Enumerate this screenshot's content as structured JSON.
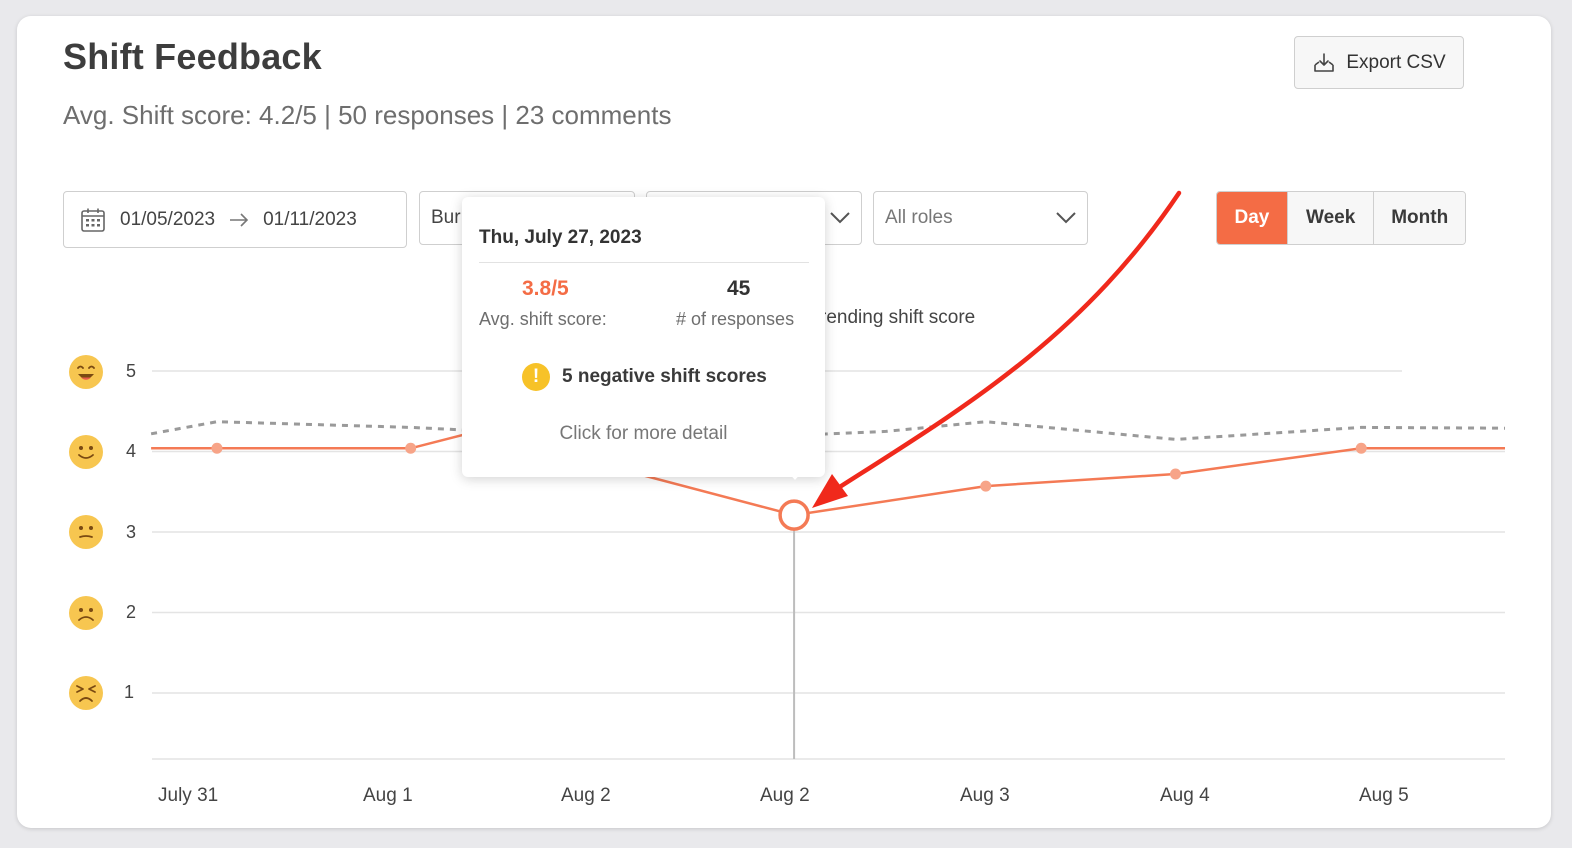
{
  "header": {
    "title": "Shift Feedback",
    "subtitle": "Avg. Shift score: 4.2/5 | 50 responses | 23 comments",
    "export_label": "Export CSV"
  },
  "filters": {
    "date_start": "01/05/2023",
    "date_end": "01/11/2023",
    "location_partial": "Bur",
    "roles": "All roles"
  },
  "period_toggle": [
    {
      "label": "Day",
      "active": true
    },
    {
      "label": "Week",
      "active": false
    },
    {
      "label": "Month",
      "active": false
    }
  ],
  "legend": {
    "trending_partial": "rending shift score"
  },
  "tooltip": {
    "date": "Thu, July 27, 2023",
    "avg_score": "3.8/5",
    "avg_score_label": "Avg. shift score:",
    "responses": "45",
    "responses_label": "# of responses",
    "warning": "5 negative shift scores",
    "warning_icon": "!",
    "link": "Click for more detail"
  },
  "colors": {
    "accent": "#f46c45",
    "score_line": "#f47a55",
    "trend_line": "#9a9a9a",
    "annotation_arrow": "#f0291c",
    "emoji": "#f7c650"
  },
  "chart_data": {
    "type": "line",
    "x_ticks": [
      "July 31",
      "Aug 1",
      "Aug 2",
      "Aug 2",
      "Aug 3",
      "Aug 4",
      "Aug 5"
    ],
    "y_ticks": [
      "5",
      "4",
      "3",
      "2",
      "1"
    ],
    "ylim": [
      0.2,
      5
    ],
    "y_emoji_icons": [
      "laughing-face-icon",
      "smiling-face-icon",
      "neutral-face-icon",
      "frowning-face-icon",
      "angry-face-icon"
    ],
    "series": [
      {
        "role": "score",
        "points": [
          [
            -0.18,
            4.04
          ],
          [
            0.15,
            4.04
          ],
          [
            1.12,
            4.04
          ],
          [
            1.45,
            4.25
          ],
          [
            3.04,
            3.21
          ],
          [
            4.0,
            3.57
          ],
          [
            4.95,
            3.72
          ],
          [
            5.88,
            4.04
          ],
          [
            6.6,
            4.04
          ]
        ]
      },
      {
        "role": "trend",
        "points": [
          [
            -0.18,
            4.22
          ],
          [
            0.15,
            4.37
          ],
          [
            1.12,
            4.3
          ],
          [
            1.45,
            4.26
          ],
          [
            3.04,
            4.2
          ],
          [
            3.5,
            4.25
          ],
          [
            4.0,
            4.37
          ],
          [
            4.95,
            4.15
          ],
          [
            5.88,
            4.3
          ],
          [
            6.6,
            4.29
          ]
        ]
      }
    ],
    "highlight_point": [
      3.04,
      3.21
    ]
  }
}
